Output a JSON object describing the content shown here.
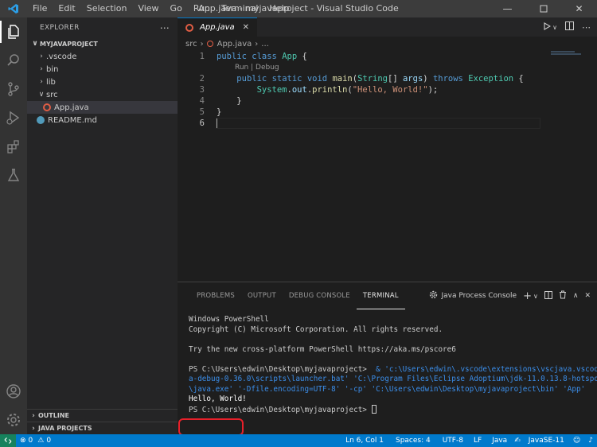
{
  "window": {
    "title": "App.java - myjavaproject - Visual Studio Code",
    "menu": [
      "File",
      "Edit",
      "Selection",
      "View",
      "Go",
      "Run",
      "Terminal",
      "Help"
    ]
  },
  "sidebar": {
    "header": "EXPLORER",
    "section": "MYJAVAPROJECT",
    "tree": [
      ".vscode",
      "bin",
      "lib",
      "src",
      "App.java",
      "README.md"
    ],
    "outline": "OUTLINE",
    "java_projects": "JAVA PROJECTS"
  },
  "editor": {
    "tab_label": "App.java",
    "breadcrumb": [
      "src",
      "App.java",
      "..."
    ],
    "codelens": "Run | Debug",
    "line_numbers": [
      "1",
      "2",
      "3",
      "4",
      "5",
      "6"
    ],
    "code": {
      "l1": [
        "public",
        "class",
        "App",
        "{"
      ],
      "l2": [
        "public",
        "static",
        "void",
        "main",
        "(",
        "String",
        "[] ",
        "args",
        ") ",
        "throws",
        "Exception",
        " {"
      ],
      "l3": [
        "System",
        ".",
        "out",
        ".",
        "println",
        "(",
        "\"Hello, World!\"",
        ");"
      ],
      "l4": "}",
      "l5": "}"
    }
  },
  "panel": {
    "tabs": [
      "PROBLEMS",
      "OUTPUT",
      "DEBUG CONSOLE",
      "TERMINAL"
    ],
    "active_tab": "TERMINAL",
    "terminal_name": "Java Process Console",
    "terminal": {
      "l1": "Windows PowerShell",
      "l2": "Copyright (C) Microsoft Corporation. All rights reserved.",
      "l3": "Try the new cross-platform PowerShell https://aka.ms/pscore6",
      "l4_prompt": "PS C:\\Users\\edwin\\Desktop\\myjavaproject> ",
      "l4_cmd": " & 'c:\\Users\\edwin\\.vscode\\extensions\\vscjava.vscode-jav",
      "l5": "a-debug-0.36.0\\scripts\\launcher.bat' 'C:\\Program Files\\Eclipse Adoptium\\jdk-11.0.13.8-hotspot\\bin",
      "l6": "\\java.exe' '-Dfile.encoding=UTF-8' '-cp' 'C:\\Users\\edwin\\Desktop\\myjavaproject\\bin' 'App'",
      "l7": "Hello, World!",
      "l8": "PS C:\\Users\\edwin\\Desktop\\myjavaproject> "
    }
  },
  "statusbar": {
    "errors": "0",
    "warnings": "0",
    "position": "Ln 6, Col 1",
    "spaces": "Spaces: 4",
    "encoding": "UTF-8",
    "eol": "LF",
    "language": "Java",
    "java_version": "JavaSE-11"
  },
  "colors": {
    "accent": "#007acc",
    "highlight_box": "#e8202a"
  }
}
